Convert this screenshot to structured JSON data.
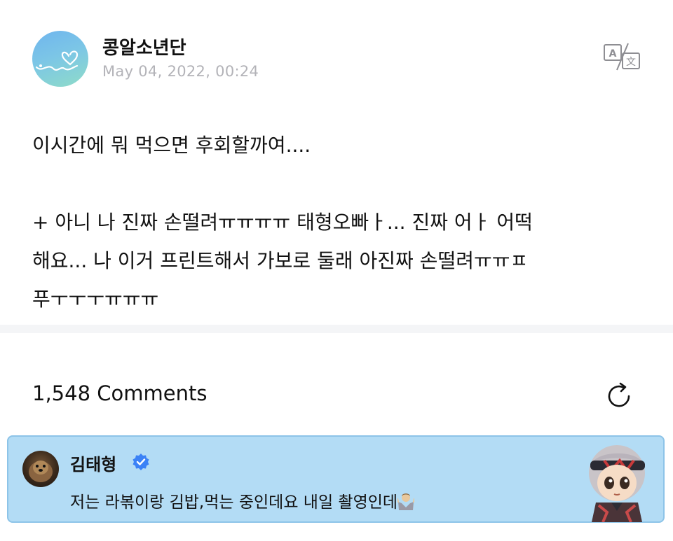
{
  "post": {
    "author": "콩알소년단",
    "date": "May 04, 2022, 00:24",
    "body_lines": [
      "이시간에 뭐 먹으면 후회할까여....",
      "",
      "+ 아니 나 진짜 손떨려ㅠㅠㅠㅠ 태형오빠ㅏ... 진짜 어ㅏ 어떡",
      "해요... 나 이거 프린트해서 가보로 둘래 아진짜 손떨려ㅠㅠㅍ",
      "푸ㅜㅜㅜㅠㅠㅠ"
    ],
    "translate_icon": "translate-icon"
  },
  "comments": {
    "count_label": "1,548 Comments",
    "refresh_icon": "refresh-icon"
  },
  "highlight_comment": {
    "author": "김태형",
    "verified_icon": "verified-badge-icon",
    "text": "저는 라볶이랑 김밥,먹는 중인데요 내일 촬영인데",
    "emoji_icon": "shrug-emoji-icon",
    "background_color": "#b3dcf5",
    "verified_color": "#3b82f6"
  }
}
